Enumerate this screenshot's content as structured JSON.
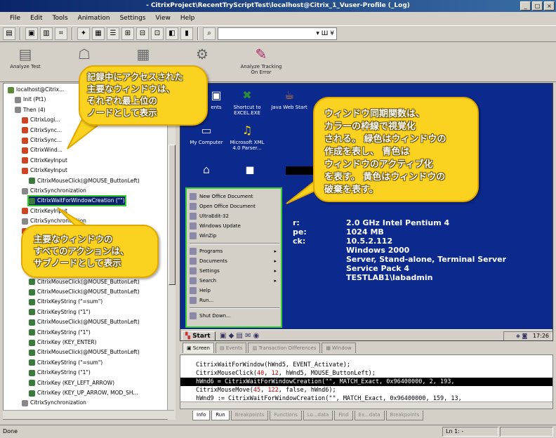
{
  "window": {
    "title": "- CitrixProject\\RecentTryScriptTest\\localhost@Citrix_1_Vuser-Profile (_Log)",
    "controls": [
      "_",
      "□",
      "×"
    ]
  },
  "menu": [
    "File",
    "Edit",
    "Tools",
    "Animation",
    "Settings",
    "View",
    "Help"
  ],
  "toolbar": {
    "combo_value": "",
    "combo_suffix": "▾ Ш ¥"
  },
  "bigbar": [
    {
      "icon": "analyze-test-icon",
      "label": "Analyze Test"
    },
    {
      "icon": "network-icon",
      "label": ""
    },
    {
      "icon": "report-icon",
      "label": ""
    },
    {
      "icon": "transaction-icon",
      "label": ""
    },
    {
      "icon": "analyze-error-icon",
      "label": "Analyze Tracking On Error"
    }
  ],
  "tree": {
    "rows": [
      {
        "label": "localhost@Citrix...",
        "indent": 0,
        "color": "#5a8a3a"
      },
      {
        "label": "Init (Pt1)",
        "indent": 1,
        "color": "#888"
      },
      {
        "label": "Then (4)",
        "indent": 1,
        "color": "#888"
      },
      {
        "label": "CitrixLogi...",
        "indent": 2,
        "color": "#cc4422"
      },
      {
        "label": "CitrixSync...",
        "indent": 2,
        "color": "#cc4422"
      },
      {
        "label": "CitrixSync...",
        "indent": 2,
        "color": "#cc4422"
      },
      {
        "label": "CitrixWind...",
        "indent": 2,
        "color": "#cc4422"
      },
      {
        "label": "CitrixKeyInput",
        "indent": 2,
        "color": "#cc4422"
      },
      {
        "label": "CitrixKeyInput",
        "indent": 2,
        "color": "#cc4422"
      },
      {
        "label": "CitrixMouseClick(@MOUSE_ButtonLeft)",
        "indent": 3,
        "color": "#3a7a3a"
      },
      {
        "label": "CitrixSynchronization",
        "indent": 2,
        "color": "#888"
      },
      {
        "label": "CitrixWaitForWindowCreation (\"\")",
        "indent": 3,
        "color": "#3a7a3a",
        "selected": true
      },
      {
        "label": "CitrixKeyInput",
        "indent": 2,
        "color": "#cc4422"
      },
      {
        "label": "CitrixSynchronization",
        "indent": 2,
        "color": "#888"
      },
      {
        "label": "CitrixKeyInput",
        "indent": 2,
        "color": "#cc4422"
      },
      {
        "label": "CitrixMouseClick(@MOUSE_ButtonLeft)",
        "indent": 3,
        "color": "#3a7a3a"
      },
      {
        "label": "CitrixSynchronization",
        "indent": 2,
        "color": "#888"
      },
      {
        "label": "CitrixKey (KEY_ENTER)",
        "indent": 3,
        "color": "#3a7a3a"
      },
      {
        "label": "CitrixMouseClick(@MOUSE_ButtonLeft)",
        "indent": 3,
        "color": "#3a7a3a"
      },
      {
        "label": "CitrixMouseClick(@MOUSE_ButtonLeft)",
        "indent": 3,
        "color": "#3a7a3a"
      },
      {
        "label": "CitrixMouseClick(@MOUSE_ButtonLeft)",
        "indent": 3,
        "color": "#3a7a3a"
      },
      {
        "label": "CitrixKeyString (\"=sum\")",
        "indent": 3,
        "color": "#3a7a3a"
      },
      {
        "label": "CitrixKeyString (\"1\")",
        "indent": 3,
        "color": "#3a7a3a"
      },
      {
        "label": "CitrixMouseClick(@MOUSE_ButtonLeft)",
        "indent": 3,
        "color": "#3a7a3a"
      },
      {
        "label": "CitrixKeyString (\"1\")",
        "indent": 3,
        "color": "#3a7a3a"
      },
      {
        "label": "CitrixKey (KEY_ENTER)",
        "indent": 3,
        "color": "#3a7a3a"
      },
      {
        "label": "CitrixMouseClick(@MOUSE_ButtonLeft)",
        "indent": 3,
        "color": "#3a7a3a"
      },
      {
        "label": "CitrixKeyString (\"=sum\")",
        "indent": 3,
        "color": "#3a7a3a"
      },
      {
        "label": "CitrixKeyString (\"1\")",
        "indent": 3,
        "color": "#3a7a3a"
      },
      {
        "label": "CitrixKey (KEY_LEFT_ARROW)",
        "indent": 3,
        "color": "#3a7a3a"
      },
      {
        "label": "CitrixKey (KEY_UP_ARROW, MOD_SH...",
        "indent": 3,
        "color": "#3a7a3a"
      },
      {
        "label": "CitrixSynchronization",
        "indent": 2,
        "color": "#888"
      }
    ]
  },
  "desktop": {
    "icons": [
      {
        "label": "ents",
        "glyph": "▣",
        "color": "#ffffff"
      },
      {
        "label": "Shortcut to EXCEL.EXE",
        "glyph": "✖",
        "color": "#2e8b3a"
      },
      {
        "label": "Java Web Start",
        "glyph": "☕",
        "color": "#e08030"
      },
      {
        "label": "My Computer",
        "glyph": "▭",
        "color": "#cccccc"
      },
      {
        "label": "Microsoft XML 4.0 Parser...",
        "glyph": "♫",
        "color": "#ffd700"
      },
      {
        "label": "",
        "glyph": "⌂",
        "color": "#cccccc"
      },
      {
        "label": "",
        "glyph": "◼",
        "color": "#ffffff"
      }
    ],
    "sysinfo": [
      {
        "key": "",
        "value": "2.0 GHz Intel Pentium 4"
      },
      {
        "key": "",
        "value": "1024 MB"
      },
      {
        "key": "",
        "value": "10.5.2.112"
      },
      {
        "key": "r:",
        "value": "Windows 2000"
      },
      {
        "key": "pe:",
        "value": "Server, Stand-alone, Terminal Server"
      },
      {
        "key": "ck:",
        "value": "Service Pack 4"
      },
      {
        "key": "",
        "value": "TESTLAB1\\labadmin"
      }
    ],
    "start_label": "Start",
    "tray_time": "17:26",
    "start_menu": [
      {
        "label": "New Office Document",
        "arrow": false
      },
      {
        "label": "Open Office Document",
        "arrow": false
      },
      {
        "label": "UltraEdit-32",
        "arrow": false
      },
      {
        "label": "Windows Update",
        "arrow": false
      },
      {
        "label": "WinZip",
        "arrow": false
      },
      {
        "sep": true
      },
      {
        "label": "Programs",
        "arrow": true
      },
      {
        "label": "Documents",
        "arrow": true
      },
      {
        "label": "Settings",
        "arrow": true
      },
      {
        "label": "Search",
        "arrow": true
      },
      {
        "label": "Help",
        "arrow": false
      },
      {
        "label": "Run...",
        "arrow": false
      },
      {
        "sep": true
      },
      {
        "label": "Shut Down...",
        "arrow": false
      }
    ]
  },
  "view_tabs": [
    "Screen",
    "Events",
    "Transaction Differences",
    "Window"
  ],
  "script": [
    {
      "text": "CitrixWaitForWindow(hWnd5, EVENT_Activate);",
      "hl": false
    },
    {
      "text": "CitrixMouseClick(40, 12, hWnd5, MOUSE_ButtonLeft);",
      "hl": false
    },
    {
      "text": "hWnd6 = CitrixWaitForWindowCreation(\"\", MATCH_Exact, 0x96400000, 2, 193,",
      "hl": true
    },
    {
      "text": "CitrixMouseMove(45, 122, false, hWnd6);",
      "hl": false
    },
    {
      "text": "hWnd9 := CitrixWaitForWindowCreation(\"\", MATCH_Exact, 0x96400000, 159, 13,",
      "hl": false
    }
  ],
  "bottom_tabs": [
    "Info",
    "Run",
    "Breakpoints",
    "Functions",
    "Lo...data",
    "Find",
    "Ex...data",
    "Breakpoints"
  ],
  "status": {
    "left": "Done",
    "mid": "Ln 1: -"
  },
  "callouts": {
    "top_left": [
      "記録中にアクセスされた",
      "主要なウィンドウは、",
      "それぞれ最上位の",
      "ノードとして表示"
    ],
    "bottom_left": [
      "主要なウィンドウの",
      "すべてのアクションは、",
      "サブノードとして表示"
    ],
    "right": [
      "ウィンドウ同期関数は、",
      "カラーの枠線で視覚化",
      "される。 緑色はウィンドウの",
      "作成を表し、 青色は",
      "ウィンドウのアクティブ化",
      "を表す。 黄色はウィンドウの",
      "破棄を表す。"
    ]
  }
}
